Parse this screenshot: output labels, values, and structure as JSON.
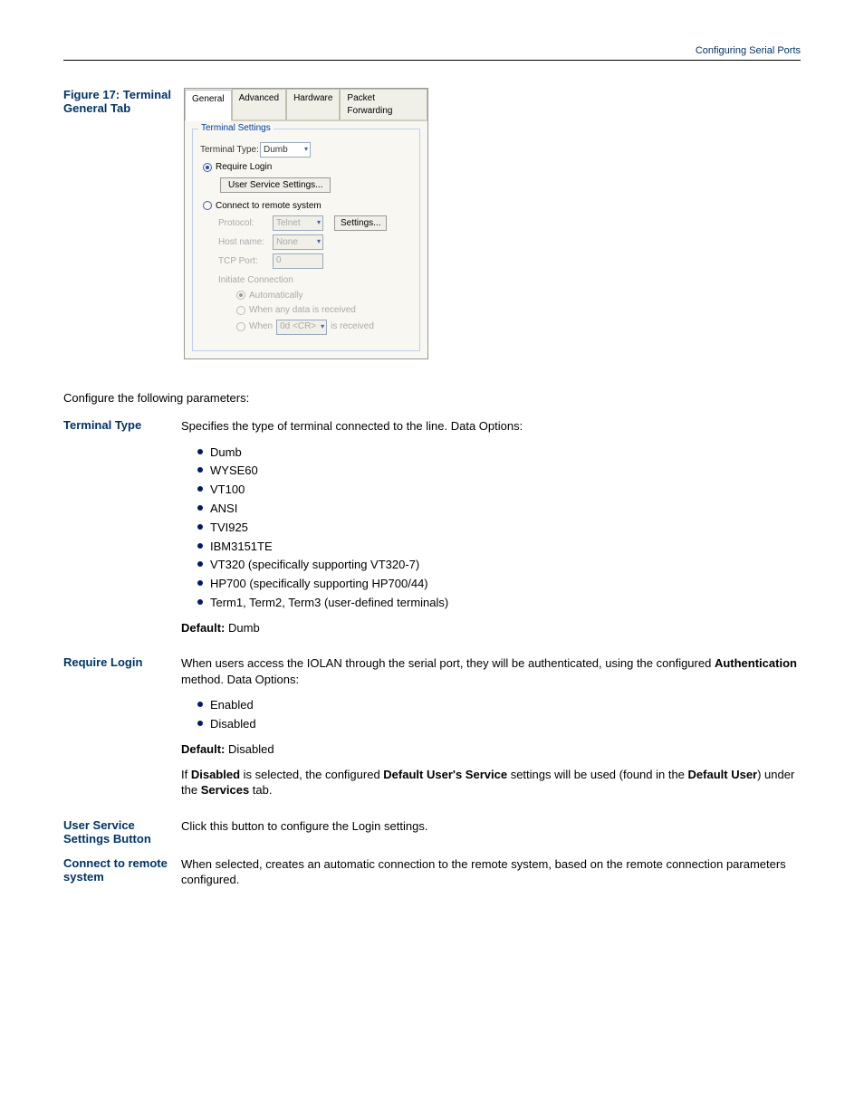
{
  "header": {
    "text": "Configuring Serial Ports"
  },
  "figure": {
    "caption": "Figure 17: Terminal General Tab"
  },
  "dialog": {
    "tabs": {
      "t0": "General",
      "t1": "Advanced",
      "t2": "Hardware",
      "t3": "Packet Forwarding"
    },
    "group": "Terminal Settings",
    "terminal_type_label": "Terminal Type:",
    "terminal_type_value": "Dumb",
    "require_login": "Require Login",
    "user_settings_btn": "User Service Settings...",
    "connect_remote": "Connect to remote system",
    "protocol_label": "Protocol:",
    "protocol_value": "Telnet",
    "settings_btn": "Settings...",
    "hostname_label": "Host name:",
    "hostname_value": "None",
    "tcpport_label": "TCP Port:",
    "tcpport_value": "0",
    "initiate_label": "Initiate Connection",
    "auto": "Automatically",
    "when_any": "When any data is received",
    "when": "When",
    "when_value": "0d  <CR>",
    "is_received": "is received"
  },
  "body": {
    "p1": "Configure the following parameters:",
    "terminal_type": {
      "label": "Terminal Type",
      "text": "Specifies the type of terminal connected to the line. Data Options:",
      "items": {
        "b0": "Dumb",
        "b1": "WYSE60",
        "b2": "VT100",
        "b3": "ANSI",
        "b4": "TVI925",
        "b5": "IBM3151TE",
        "b6": "VT320 (specifically supporting VT320-7)",
        "b7": "HP700 (specifically supporting HP700/44)",
        "b8": "Term1, Term2, Term3 (user-defined terminals)"
      },
      "default": "Default: Dumb",
      "default_label": "Default:",
      "default_value": "Dumb"
    },
    "require_login": {
      "label": "Require Login",
      "p1_a": "When users access the IOLAN through the serial port, they will be authenticated, using the configured ",
      "p1_b": "Authentication",
      "p1_c": " method. Data Options:",
      "items": {
        "b0": "Enabled",
        "b1": "Disabled"
      },
      "default_label": "Default:",
      "default_value": "Disabled",
      "p2_a": "If ",
      "p2_b": "Disabled",
      "p2_c": " is selected, the configured ",
      "p2_d": "Default User's Service",
      "p2_e": " settings will be used (found in the ",
      "p2_f": "Default User",
      "p2_g": ") under the ",
      "p2_h": "Services",
      "p2_i": " tab."
    },
    "user_service": {
      "label": "User Service Settings Button",
      "p": "Click this button to configure the Login settings."
    },
    "connect_remote": {
      "label": "Connect to remote system",
      "p": "When selected, creates an automatic connection to the remote system, based on the remote connection parameters configured."
    }
  }
}
